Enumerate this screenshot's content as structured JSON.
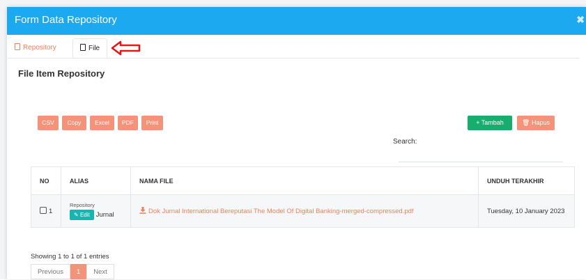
{
  "modal": {
    "title": "Form Data Repository",
    "close_glyph": "✖"
  },
  "tabs": [
    {
      "label": "Repository",
      "active": false
    },
    {
      "label": "File",
      "active": true
    }
  ],
  "section": {
    "title": "File Item Repository"
  },
  "export_buttons": [
    "CSV",
    "Copy",
    "Excel",
    "PDF",
    "Print"
  ],
  "actions": {
    "add_label": "+ Tambah",
    "delete_label": "Hapus"
  },
  "search": {
    "label": "Search:",
    "value": ""
  },
  "table": {
    "headers": [
      "NO",
      "ALIAS",
      "NAMA FILE",
      "UNDUH TERAKHIR"
    ],
    "rows": [
      {
        "no": "1",
        "alias_top": "Repository",
        "edit_label": "Edit",
        "alias_after": "Jurnal",
        "file": "Dok Jurnal International Bereputasi The Model Of Digital Banking-merged-compressed.pdf",
        "last_download": "Tuesday, 10 January 2023"
      }
    ]
  },
  "footer": {
    "showing": "Showing 1 to 1 of 1 entries",
    "prev": "Previous",
    "page": "1",
    "next": "Next"
  },
  "colors": {
    "header": "#1ca9f0",
    "accent": "#f4937a",
    "add": "#17ad6e",
    "edit": "#17b5b0",
    "arrow": "#e0191c"
  }
}
